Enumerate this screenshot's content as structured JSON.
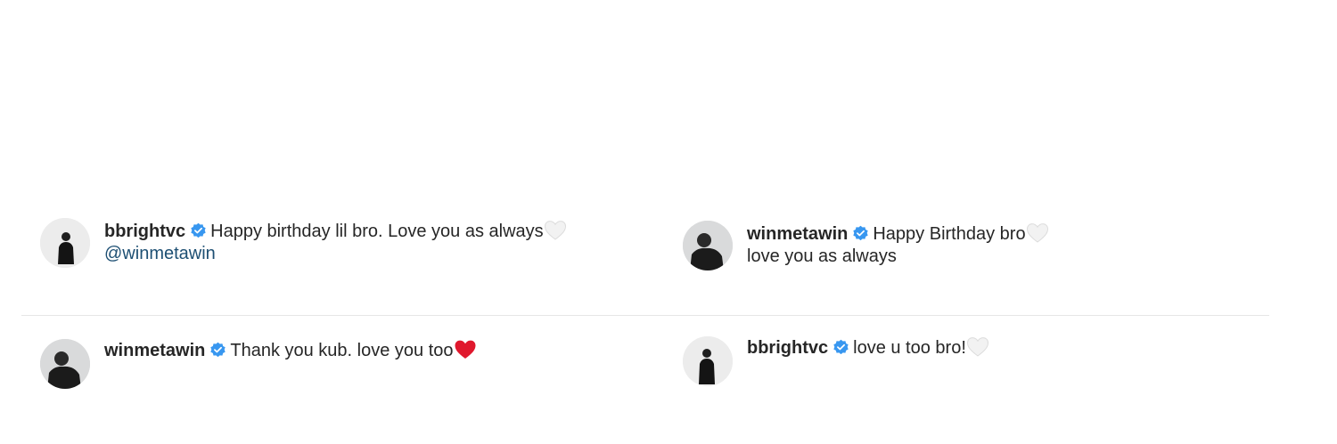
{
  "comments": [
    {
      "username": "bbrightvc",
      "text": "Happy birthday lil bro. Love you as always",
      "mention": "@winmetawin",
      "heart": "white-heart-icon"
    },
    {
      "username": "winmetawin",
      "text": "Happy Birthday bro",
      "line2": "love you as always",
      "heart": "white-heart-icon"
    },
    {
      "username": "winmetawin",
      "text": "Thank you kub. love you too",
      "heart": "red-heart-icon"
    },
    {
      "username": "bbrightvc",
      "text": "love u too bro!",
      "heart": "white-heart-icon"
    }
  ],
  "colors": {
    "verified": "#3897f0",
    "mention": "#1d4f73",
    "red_heart": "#e0182d",
    "white_heart": "#f2f2f2"
  }
}
